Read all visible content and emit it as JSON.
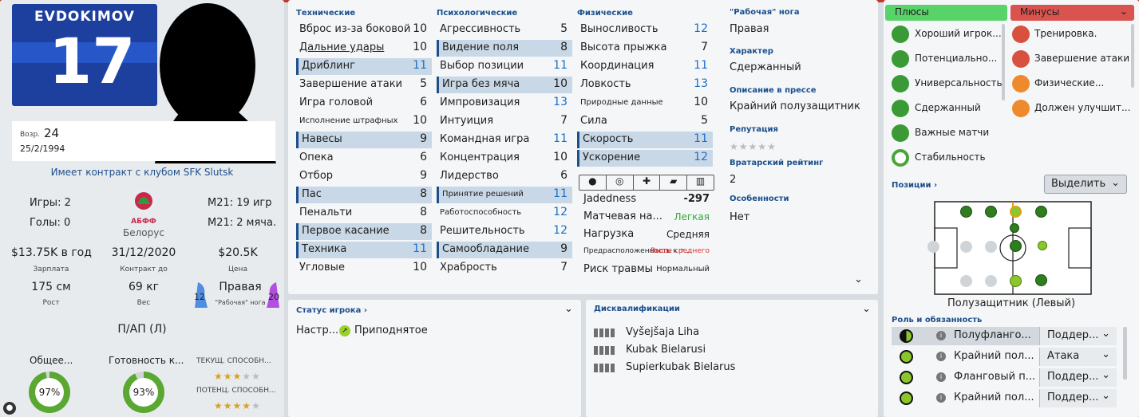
{
  "player": {
    "surname": "EVDOKIMOV",
    "number": "17",
    "age_label": "Возр.",
    "age": "24",
    "dob": "25/2/1994",
    "contract_club": "Имеет контракт с клубом SFK Slutsk"
  },
  "career": {
    "games": "Игры: 2",
    "goals": "Голы: 0",
    "u21_games": "М21: 19 игр",
    "u21_goals": "М21: 2 мяча.",
    "nation": "Белорус",
    "fed_logo": "АБФФ"
  },
  "finance": {
    "wage": "$13.75K в год",
    "wage_label": "Зарплата",
    "contract_end": "31/12/2020",
    "contract_label": "Контракт до",
    "value": "$20.5K",
    "value_label": "Цена"
  },
  "physique": {
    "height": "175 см",
    "height_label": "Рост",
    "weight": "69 кг",
    "weight_label": "Вес",
    "foot": "Правая",
    "foot_label": "\"Рабочая\" нога",
    "left_foot": "12",
    "right_foot": "20"
  },
  "position_short": "П/АП (Л)",
  "bottom_stats": {
    "overall_label": "Общее...",
    "overall": "97%",
    "overall_pct": 97,
    "readiness_label": "Готовность к...",
    "readiness": "93%",
    "readiness_pct": 93,
    "current_ability_label": "ТЕКУЩ. СПОСОБН...",
    "current_ability_stars": 3,
    "potential_ability_label": "ПОТЕНЦ. СПОСОБН...",
    "potential_ability_stars": 4
  },
  "attr_headers": {
    "technical": "Технические",
    "mental": "Психологические",
    "physical": "Физические"
  },
  "technical": [
    {
      "name": "Вброс из-за боковой",
      "value": "10",
      "hl": false,
      "blue": false,
      "sm": false,
      "und": false
    },
    {
      "name": "Дальние удары",
      "value": "10",
      "hl": false,
      "blue": false,
      "sm": false,
      "und": true
    },
    {
      "name": "Дриблинг",
      "value": "11",
      "hl": true,
      "blue": true,
      "sm": false,
      "und": false
    },
    {
      "name": "Завершение атаки",
      "value": "5",
      "hl": false,
      "blue": false,
      "sm": false,
      "und": false
    },
    {
      "name": "Игра головой",
      "value": "6",
      "hl": false,
      "blue": false,
      "sm": false,
      "und": false
    },
    {
      "name": "Исполнение штрафных",
      "value": "10",
      "hl": false,
      "blue": false,
      "sm": true,
      "und": false
    },
    {
      "name": "Навесы",
      "value": "9",
      "hl": true,
      "blue": false,
      "sm": false,
      "und": false
    },
    {
      "name": "Опека",
      "value": "6",
      "hl": false,
      "blue": false,
      "sm": false,
      "und": false
    },
    {
      "name": "Отбор",
      "value": "9",
      "hl": false,
      "blue": false,
      "sm": false,
      "und": false
    },
    {
      "name": "Пас",
      "value": "8",
      "hl": true,
      "blue": false,
      "sm": false,
      "und": false
    },
    {
      "name": "Пенальти",
      "value": "8",
      "hl": false,
      "blue": false,
      "sm": false,
      "und": false
    },
    {
      "name": "Первое касание",
      "value": "8",
      "hl": true,
      "blue": false,
      "sm": false,
      "und": false
    },
    {
      "name": "Техника",
      "value": "11",
      "hl": true,
      "blue": true,
      "sm": false,
      "und": false
    },
    {
      "name": "Угловые",
      "value": "10",
      "hl": false,
      "blue": false,
      "sm": false,
      "und": false
    }
  ],
  "mental": [
    {
      "name": "Агрессивность",
      "value": "5",
      "hl": false,
      "blue": false,
      "sm": false
    },
    {
      "name": "Видение поля",
      "value": "8",
      "hl": true,
      "blue": false,
      "sm": false
    },
    {
      "name": "Выбор позиции",
      "value": "11",
      "hl": false,
      "blue": true,
      "sm": false
    },
    {
      "name": "Игра без мяча",
      "value": "10",
      "hl": true,
      "blue": false,
      "sm": false
    },
    {
      "name": "Импровизация",
      "value": "13",
      "hl": false,
      "blue": true,
      "sm": false
    },
    {
      "name": "Интуиция",
      "value": "7",
      "hl": false,
      "blue": false,
      "sm": false
    },
    {
      "name": "Командная игра",
      "value": "11",
      "hl": false,
      "blue": true,
      "sm": false
    },
    {
      "name": "Концентрация",
      "value": "10",
      "hl": false,
      "blue": false,
      "sm": false
    },
    {
      "name": "Лидерство",
      "value": "6",
      "hl": false,
      "blue": false,
      "sm": false
    },
    {
      "name": "Принятие решений",
      "value": "11",
      "hl": true,
      "blue": true,
      "sm": true
    },
    {
      "name": "Работоспособность",
      "value": "12",
      "hl": false,
      "blue": true,
      "sm": true
    },
    {
      "name": "Решительность",
      "value": "12",
      "hl": false,
      "blue": true,
      "sm": false
    },
    {
      "name": "Самообладание",
      "value": "9",
      "hl": true,
      "blue": false,
      "sm": false
    },
    {
      "name": "Храбрость",
      "value": "7",
      "hl": false,
      "blue": false,
      "sm": false
    }
  ],
  "physical": [
    {
      "name": "Выносливость",
      "value": "12",
      "hl": false,
      "blue": true,
      "sm": false
    },
    {
      "name": "Высота прыжка",
      "value": "7",
      "hl": false,
      "blue": false,
      "sm": false
    },
    {
      "name": "Координация",
      "value": "11",
      "hl": false,
      "blue": true,
      "sm": false
    },
    {
      "name": "Ловкость",
      "value": "13",
      "hl": false,
      "blue": true,
      "sm": false
    },
    {
      "name": "Природные данные",
      "value": "10",
      "hl": false,
      "blue": false,
      "sm": true
    },
    {
      "name": "Сила",
      "value": "5",
      "hl": false,
      "blue": false,
      "sm": false
    },
    {
      "name": "Скорость",
      "value": "11",
      "hl": true,
      "blue": true,
      "sm": false
    },
    {
      "name": "Ускорение",
      "value": "12",
      "hl": true,
      "blue": true,
      "sm": false
    }
  ],
  "condition": {
    "jadedness_label": "Jadedness",
    "jadedness": "-297",
    "match_label": "Матчевая на...",
    "match": "Легкая",
    "load_label": "Нагрузка",
    "load": "Средняя",
    "injury_prone_label": "Предрасположенность к т...",
    "injury_prone": "Выше среднего",
    "injury_risk_label": "Риск травмы",
    "injury_risk": "Нормальный"
  },
  "info": {
    "foot_label": "\"Рабочая\" нога",
    "foot": "Правая",
    "character_label": "Характер",
    "character": "Сдержанный",
    "press_label": "Описание в прессе",
    "press": "Крайний полузащитник",
    "reputation_label": "Репутация",
    "reputation_stars": 0,
    "gk_rating_label": "Вратарский рейтинг",
    "gk_rating": "2",
    "traits_label": "Особенности",
    "traits": "Нет"
  },
  "status": {
    "title": "Статус игрока",
    "mood_label": "Настр...",
    "mood": "Приподнятое"
  },
  "disq": {
    "title": "Дисквалификации",
    "items": [
      "Vyšejšaja Liha",
      "Kubak Bielarusi",
      "Supierkubak Bielarus"
    ]
  },
  "pros_cons": {
    "pros_title": "Плюсы",
    "cons_title": "Минусы",
    "pros_color": "#58d36a",
    "cons_color": "#d9534f",
    "pros": [
      "Хороший игрок...",
      "Потенциально...",
      "Универсальность",
      "Сдержанный",
      "Важные матчи",
      "Стабильность"
    ],
    "cons": [
      "Тренировка.",
      "Завершение атаки",
      "Физические...",
      "Должен улучшит..."
    ]
  },
  "positions": {
    "title": "Позиции",
    "select_label": "Выделить",
    "position_name": "Полузащитник (Левый)"
  },
  "roles": {
    "title": "Роль и обязанность",
    "rows": [
      {
        "role": "Полуфланго...",
        "duty": "Поддер..."
      },
      {
        "role": "Крайний пол...",
        "duty": "Атака"
      },
      {
        "role": "Фланговый п...",
        "duty": "Поддер..."
      },
      {
        "role": "Крайний пол...",
        "duty": "Поддер..."
      }
    ]
  }
}
